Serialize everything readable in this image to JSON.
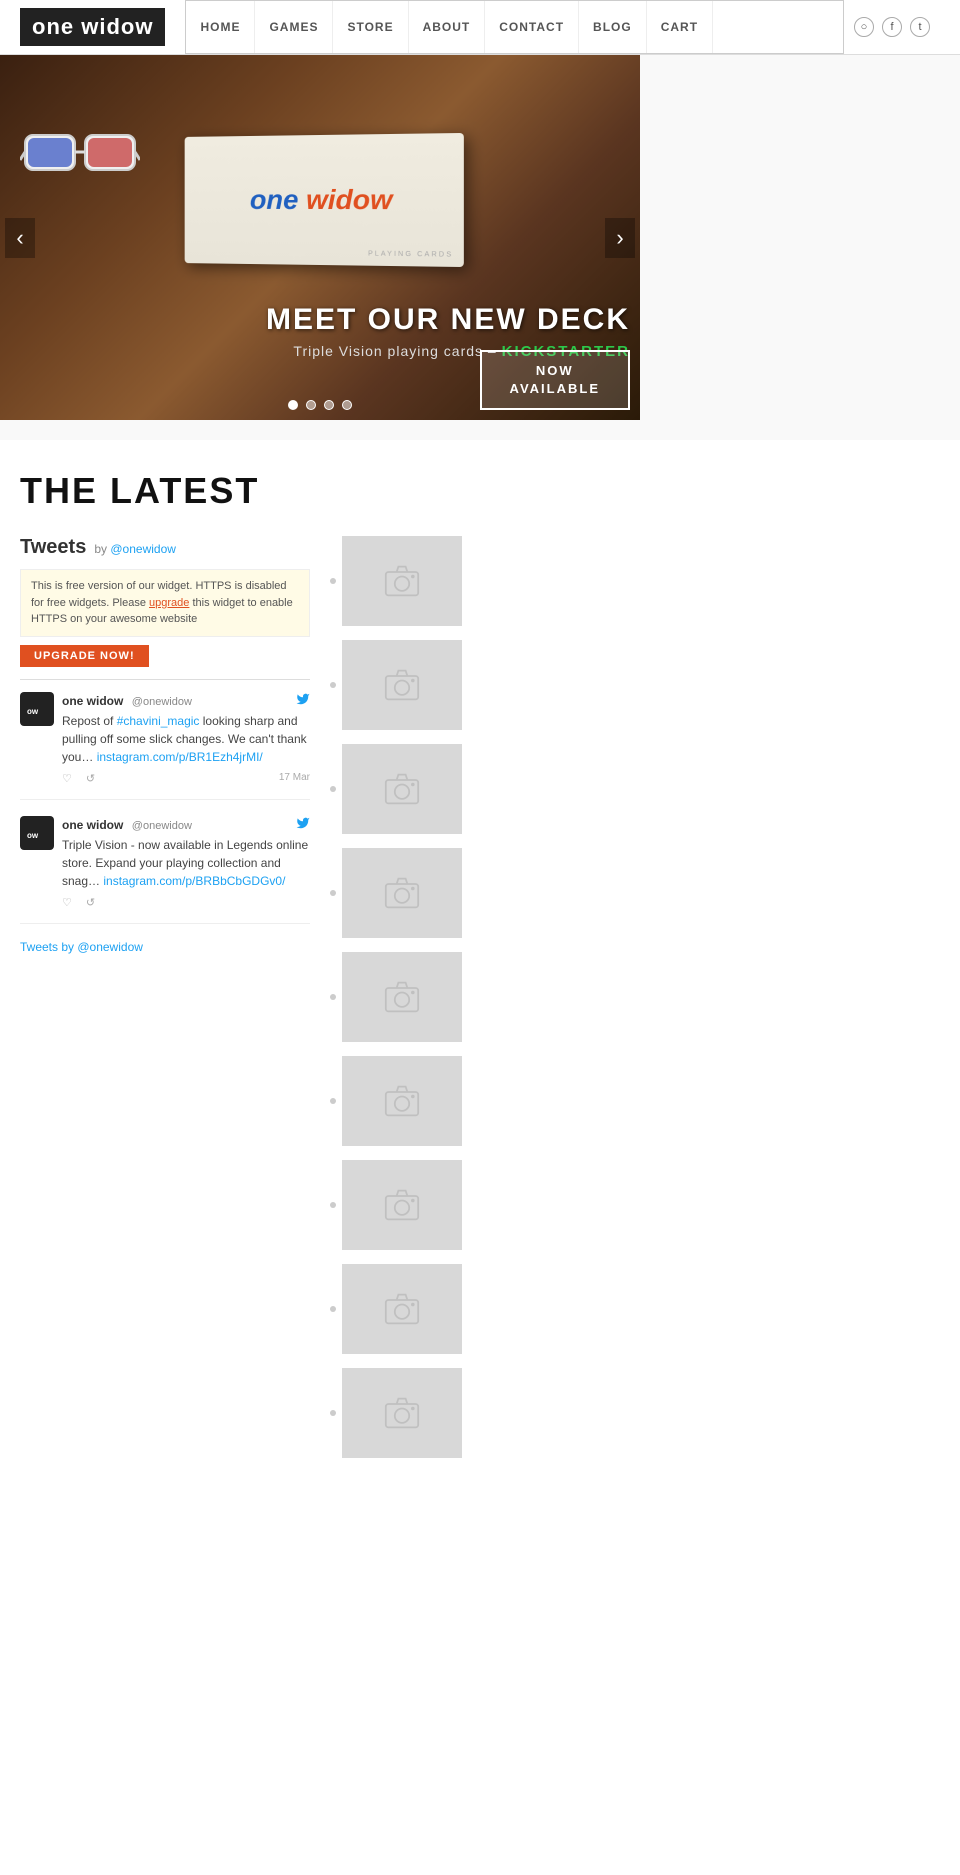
{
  "header": {
    "logo_line1": "one widow",
    "nav_items": [
      {
        "label": "HOME",
        "href": "#"
      },
      {
        "label": "GAMES",
        "href": "#"
      },
      {
        "label": "STORE",
        "href": "#"
      },
      {
        "label": "ABOUT",
        "href": "#"
      },
      {
        "label": "CONTACT",
        "href": "#"
      },
      {
        "label": "BLOG",
        "href": "#"
      },
      {
        "label": "CART",
        "href": "#"
      }
    ],
    "social": [
      "circle-icon",
      "facebook-icon",
      "twitter-icon"
    ]
  },
  "hero": {
    "slide_title": "MEET OUR NEW DECK",
    "slide_subtitle": "Triple Vision playing cards –",
    "slide_kickstarter": "KICKSTARTER",
    "cta_line1": "NOW",
    "cta_line2": "AVAILABLE",
    "dots": [
      true,
      false,
      false,
      false
    ],
    "prev_label": "‹",
    "next_label": "›",
    "box_text_one": "one",
    "box_text_widow": "widow",
    "box_subtext": "PLAYING CARDS"
  },
  "latest": {
    "section_title": "THE LATEST"
  },
  "tweets": {
    "title": "Tweets",
    "by_label": "by",
    "by_handle": "@onewidow",
    "widget_notice": "This is free version of our widget. HTTPS is disabled for free widgets. Please upgrade this widget to enable HTTPS on your awesome website",
    "upgrade_label": "UPGRADE NOW!",
    "items": [
      {
        "user": "one widow",
        "handle": "@onewidow",
        "text_before": "Repost of ",
        "link1": "#chavini_magic",
        "text_middle": " looking sharp and pulling off some slick changes. We can't thank you… ",
        "link2": "instagram.com/p/BR1Ezh4jrMI/",
        "actions": [
          "♡",
          "↺"
        ]
      },
      {
        "user": "one widow",
        "handle": "@onewidow",
        "text": "Triple Vision - now available in Legends online store. Expand your playing collection and snag…",
        "link": "instagram.com/p/BRBbCbGDGv0/",
        "actions": [
          "♡",
          "↺"
        ]
      }
    ],
    "footer": "Tweets by @onewidow"
  },
  "instagram": {
    "items": [
      {
        "alt": "instagram photo 1"
      },
      {
        "alt": "instagram photo 2"
      },
      {
        "alt": "instagram photo 3"
      },
      {
        "alt": "instagram photo 4"
      },
      {
        "alt": "instagram photo 5"
      },
      {
        "alt": "instagram photo 6"
      },
      {
        "alt": "instagram photo 7"
      },
      {
        "alt": "instagram photo 8"
      },
      {
        "alt": "instagram photo 9"
      }
    ]
  }
}
